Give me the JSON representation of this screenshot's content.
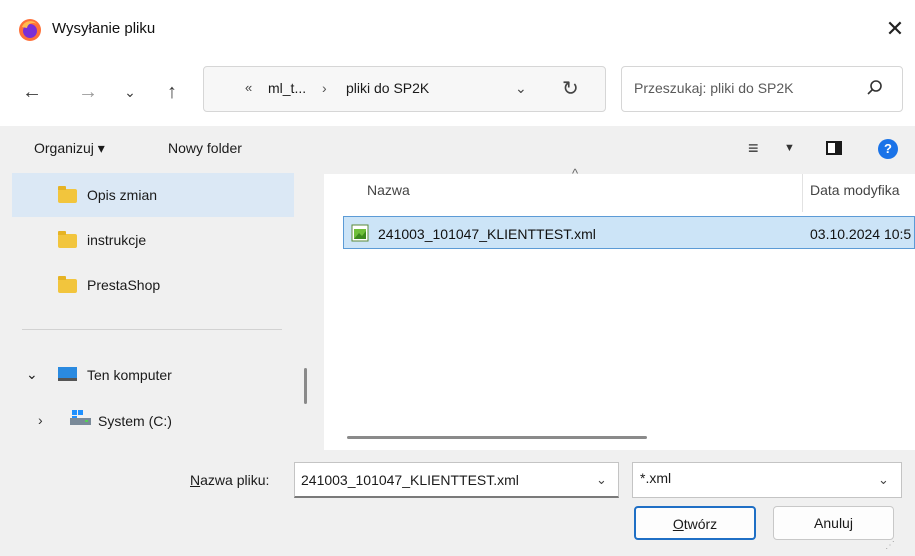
{
  "window": {
    "title": "Wysyłanie pliku",
    "close_glyph": "✕"
  },
  "nav": {
    "back_glyph": "←",
    "forward_glyph": "→",
    "recent_glyph": "⌄",
    "up_glyph": "↑",
    "refresh_glyph": "↻",
    "address_dropdown_glyph": "⌄"
  },
  "address": {
    "overflow": "«",
    "crumbs": [
      "ml_t...",
      "pliki do SP2K"
    ],
    "separator": "›"
  },
  "search": {
    "placeholder": "Przeszukaj: pliki do SP2K"
  },
  "toolbar": {
    "organize_label": "Organizuj ▾",
    "new_folder_label": "Nowy folder",
    "view_glyph": "≡",
    "view_dropdown_glyph": "▼",
    "help_glyph": "?"
  },
  "sidebar": {
    "items": [
      {
        "label": "Opis zmian",
        "icon": "folder-icon",
        "selected": true
      },
      {
        "label": "instrukcje",
        "icon": "folder-icon"
      },
      {
        "label": "PrestaShop",
        "icon": "folder-icon"
      }
    ],
    "computer": {
      "label": "Ten komputer",
      "chevron": "⌄",
      "icon": "computer-icon"
    },
    "system": {
      "label": "System (C:)",
      "chevron": "›",
      "icon": "drive-icon"
    }
  },
  "filelist": {
    "sort_glyph": "^",
    "columns": [
      "Nazwa",
      "Data modyfika"
    ],
    "rows": [
      {
        "name": "241003_101047_KLIENTTEST.xml",
        "date": "03.10.2024 10:5",
        "selected": true
      }
    ]
  },
  "bottom": {
    "filename_label_accel": "N",
    "filename_label_rest": "azwa pliku:",
    "filename_value": "241003_101047_KLIENTTEST.xml",
    "dropdown_glyph": "⌄",
    "filter_value": "*.xml",
    "open_label_accel": "O",
    "open_label_rest": "twórz",
    "cancel_label": "Anuluj"
  },
  "colors": {
    "selection_bg": "#cce4f7",
    "selection_border": "#5c9bd6",
    "sidebar_selected_bg": "#dbe8f5",
    "accent": "#1f6fc5",
    "folder": "#f2c53d",
    "help": "#1a73e8"
  }
}
